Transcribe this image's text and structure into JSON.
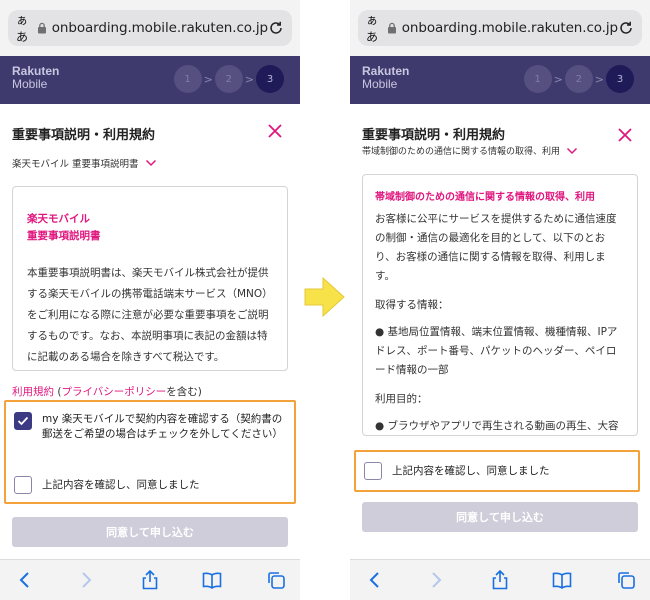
{
  "browser": {
    "aa_label": "ぁあ",
    "url": "onboarding.mobile.rakuten.co.jp"
  },
  "header": {
    "logo_line1": "Rakuten",
    "logo_line2": "Mobile",
    "steps": [
      "1",
      "2",
      "3"
    ],
    "step_sep": ">"
  },
  "left_screen": {
    "title": "重要事項説明・利用規約",
    "doc_selector": "楽天モバイル 重要事項説明書",
    "doc_title_line1": "楽天モバイル",
    "doc_title_line2": "重要事項説明書",
    "doc_body": "本重要事項説明書は、楽天モバイル株式会社が提供する楽天モバイルの携帯電話端末サービス（MNO）をご利用になる際に注意が必要な重要事項をご説明するものです。なお、本説明事項に表記の金額は特に記載のある場合を除きすべて税込です。",
    "links_terms": "利用規約",
    "links_open": "(",
    "links_privacy": "プライバシーポリシー",
    "links_close": "を含む)",
    "checkbox1_label": "my 楽天モバイルで契約内容を確認する（契約書の郵送をご希望の場合はチェックを外してください）",
    "checkbox1_checked": true,
    "checkbox2_label": "上記内容を確認し、同意しました",
    "checkbox2_checked": false,
    "submit_label": "同意して申し込む"
  },
  "right_screen": {
    "title": "重要事項説明・利用規約",
    "doc_selector": "帯域制御のための通信に関する情報の取得、利用",
    "doc_title": "帯域制御のための通信に関する情報の取得、利用",
    "doc_body": "お客様に公平にサービスを提供するために通信速度の制御・通信の最適化を目的として、以下のとおり、お客様の通信に関する情報を取得、利用します。",
    "acquire_heading": "取得する情報：",
    "acquire_item": "● 基地局位置情報、端末位置情報、機種情報、IPアドレス、ポート番号、パケットのヘッダー、ペイロード情報の一部",
    "purpose_heading": "利用目的：",
    "purpose_item": "● ブラウザやアプリで再生される動画の再生、大容量ファイルのダウンロード等大容量の通",
    "checkbox_label": "上記内容を確認し、同意しました",
    "checkbox_checked": false,
    "submit_label": "同意して申し込む"
  },
  "colors": {
    "brand_purple": "#3f3a6e",
    "accent_pink": "#e0177f",
    "highlight_orange": "#f3a23a",
    "arrow_yellow": "#f7e24a",
    "disabled_button": "#cfcdd9",
    "ios_blue": "#1a6fe0"
  },
  "icons": {
    "lock": "lock-icon",
    "reload": "reload-icon",
    "close": "close-icon",
    "chevron": "chevron-down-icon",
    "back": "back-icon",
    "forward": "forward-icon",
    "share": "share-icon",
    "bookmarks": "book-icon",
    "tabs": "tabs-icon",
    "transition_arrow": "arrow-right-icon"
  }
}
